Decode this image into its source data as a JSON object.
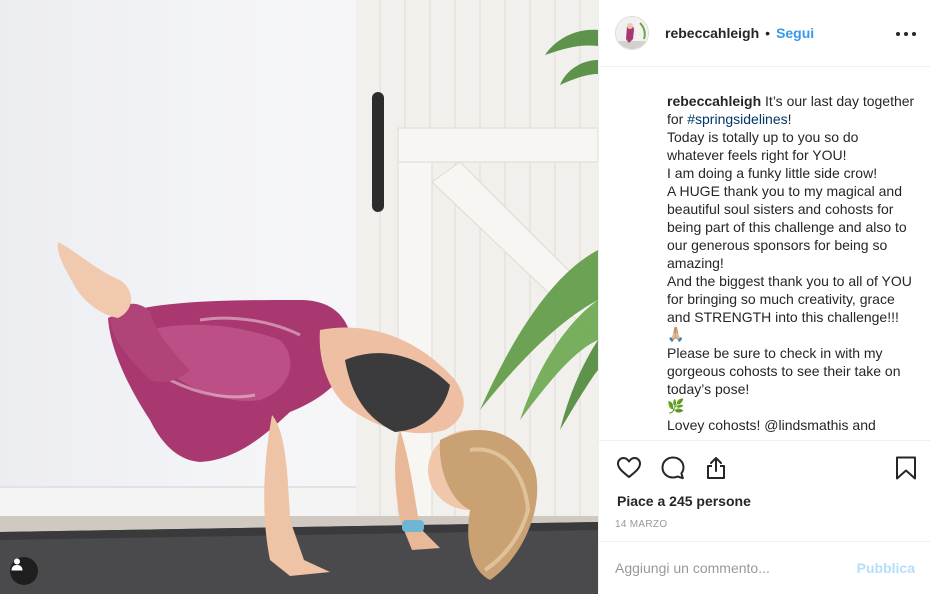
{
  "post": {
    "username": "rebeccahleigh",
    "separator": "•",
    "follow_label": "Segui",
    "more_icon": "more-options-icon"
  },
  "caption": {
    "username": "rebeccahleigh",
    "intro": " It’s our last day together for ",
    "hashtag": "#springsidelines",
    "after_hashtag": "!",
    "lines": [
      "Today is totally up to you so do whatever feels right for YOU!",
      "I am doing a funky little side crow!",
      "A HUGE thank you to my magical and beautiful soul sisters and cohosts for being part of this challenge and also to our generous sponsors for being so amazing!",
      "And the biggest thank you to all of YOU for bringing so much creativity, grace and STRENGTH into this challenge!!!",
      "🙏🏼",
      "Please be sure to check in with my gorgeous cohosts to see their take on today’s pose!",
      "🌿",
      "Lovey cohosts! @lindsmathis and"
    ]
  },
  "actions": {
    "like_icon": "heart-icon",
    "comment_icon": "comment-icon",
    "share_icon": "share-icon",
    "save_icon": "bookmark-icon"
  },
  "likes_text": "Piace a 245 persone",
  "date_text": "14 MARZO",
  "comment": {
    "placeholder": "Aggiungi un commento...",
    "publish_label": "Pubblica"
  },
  "colors": {
    "link_blue": "#3897f0",
    "hashtag": "#003569",
    "publish_disabled": "#b2dffc",
    "border": "#efefef"
  }
}
